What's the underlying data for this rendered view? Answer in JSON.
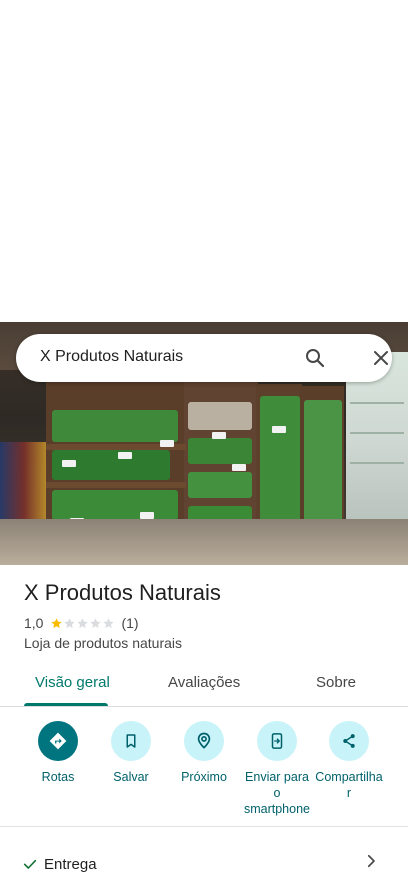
{
  "search": {
    "query": "X Produtos Naturais"
  },
  "place": {
    "title": "X Produtos Naturais",
    "rating": "1,0",
    "stars_filled": 1,
    "stars_total": 5,
    "review_count": "(1)",
    "category": "Loja de produtos naturais"
  },
  "tabs": [
    {
      "label": "Visão geral",
      "active": true
    },
    {
      "label": "Avaliações",
      "active": false
    },
    {
      "label": "Sobre",
      "active": false
    }
  ],
  "actions": [
    {
      "label": "Rotas",
      "icon": "directions-icon"
    },
    {
      "label": "Salvar",
      "icon": "bookmark-icon"
    },
    {
      "label": "Próximo",
      "icon": "nearby-icon"
    },
    {
      "label": "Enviar para o smartphone",
      "label_lines": [
        "Enviar para",
        "o",
        "smartphone"
      ],
      "icon": "send-to-phone-icon"
    },
    {
      "label": "Compartilhar",
      "label_lines": [
        "Compartilha",
        "r"
      ],
      "icon": "share-icon"
    }
  ],
  "details": {
    "delivery_label": "Entrega"
  },
  "colors": {
    "accent": "#00796b",
    "star": "#fbbc04",
    "action_bg": "#c8f3f8",
    "primary_action": "#00757f"
  }
}
